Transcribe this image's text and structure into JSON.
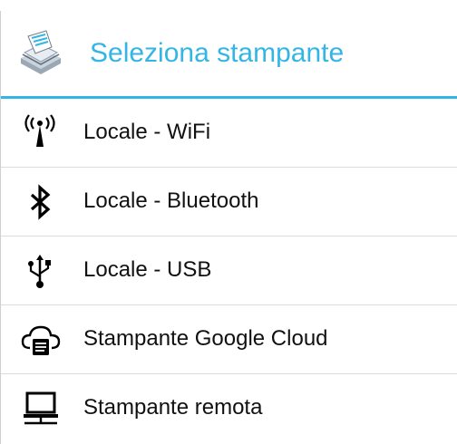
{
  "dialog": {
    "title": "Seleziona stampante",
    "accent_color": "#33b5e5",
    "header_icon": "printer-app-icon"
  },
  "items": [
    {
      "label": "Locale - WiFi",
      "icon": "wifi-antenna-icon"
    },
    {
      "label": "Locale - Bluetooth",
      "icon": "bluetooth-icon"
    },
    {
      "label": "Locale - USB",
      "icon": "usb-icon"
    },
    {
      "label": "Stampante Google Cloud",
      "icon": "cloud-printer-icon"
    },
    {
      "label": "Stampante remota",
      "icon": "remote-computer-icon"
    }
  ]
}
